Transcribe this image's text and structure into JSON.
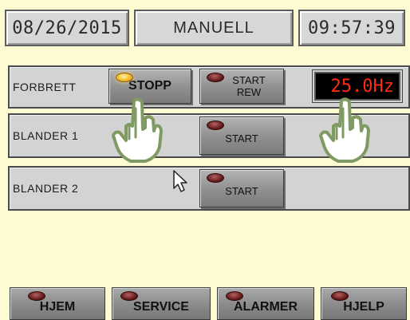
{
  "header": {
    "date": "08/26/2015",
    "mode": "MANUELL",
    "time": "09:57:39"
  },
  "rows": [
    {
      "label": "FORBRETT",
      "buttons": [
        {
          "label": "STOPP",
          "lamp": "on"
        },
        {
          "label_line1": "START",
          "label_line2": "REW",
          "lamp": "off"
        }
      ],
      "frequency": "25.0Hz"
    },
    {
      "label": "BLANDER 1",
      "buttons": [
        {
          "label": "START",
          "lamp": "off"
        }
      ]
    },
    {
      "label": "BLANDER 2",
      "buttons": [
        {
          "label": "START",
          "lamp": "off"
        }
      ]
    }
  ],
  "nav": {
    "home": "HJEM",
    "service": "SERVICE",
    "alarms": "ALARMER",
    "help": "HJELP"
  },
  "colors": {
    "background": "#fdfbd2",
    "panel": "#d3d3d3",
    "lamp_on": "#f5b92a",
    "lamp_off": "#5c1212",
    "frequency_text": "#ff2a14"
  },
  "icons": {
    "touch_hands": [
      "hand-pointer-icon",
      "hand-pointer-icon"
    ],
    "cursor": "mouse-cursor-icon"
  }
}
